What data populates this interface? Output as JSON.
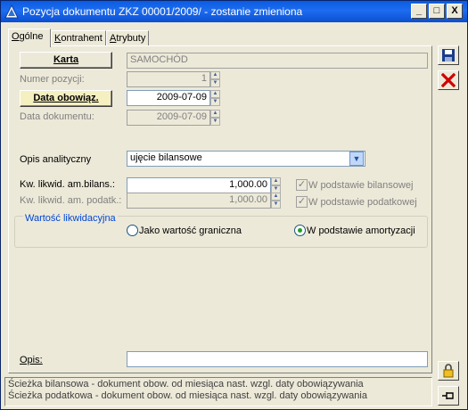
{
  "window": {
    "title": "Pozycja dokumentu ZKZ 00001/2009/ - zostanie zmieniona",
    "controls": [
      "_",
      "□",
      "X"
    ]
  },
  "tabs": [
    {
      "label_u": "O",
      "label_rest": "gólne"
    },
    {
      "label_u": "K",
      "label_rest": "ontrahent"
    },
    {
      "label_u": "A",
      "label_rest": "trybuty"
    }
  ],
  "form": {
    "karta_button": "Karta",
    "karta_value": "SAMOCHÓD",
    "numer_label": "Numer pozycji:",
    "numer_value": "1",
    "data_obow_button": "Data obowiąz.",
    "data_obow_value": "2009-07-09",
    "data_dok_label": "Data dokumentu:",
    "data_dok_value": "2009-07-09",
    "opis_analityczny_label": "Opis analityczny",
    "opis_analityczny_value": "ujęcie bilansowe",
    "kw_bilans_label": "Kw. likwid. am.bilans.:",
    "kw_bilans_value": "1,000.00",
    "kw_podatk_label": "Kw. likwid. am. podatk.:",
    "kw_podatk_value": "1,000.00",
    "chk_bilans_label": "W podstawie bilansowej",
    "chk_podatk_label": "W podstawie podatkowej",
    "wartosc_group_title": "Wartość likwidacyjna",
    "radio_graniczna_label": "Jako wartość graniczna",
    "radio_amortyzacji_label": "W podstawie amortyzacji",
    "radio_selected": "W podstawie amortyzacji",
    "opis_label": "Opis:",
    "opis_value": ""
  },
  "status": {
    "line1": "Ścieżka bilansowa - dokument obow. od miesiąca nast. wzgl. daty obowiązywania",
    "line2": "Ścieżka podatkowa - dokument obow. od miesiąca nast. wzgl. daty obowiązywania"
  },
  "colors": {
    "titlebar": "#0a5ce0",
    "link_blue": "#0046d5",
    "delete_red": "#d00000"
  }
}
